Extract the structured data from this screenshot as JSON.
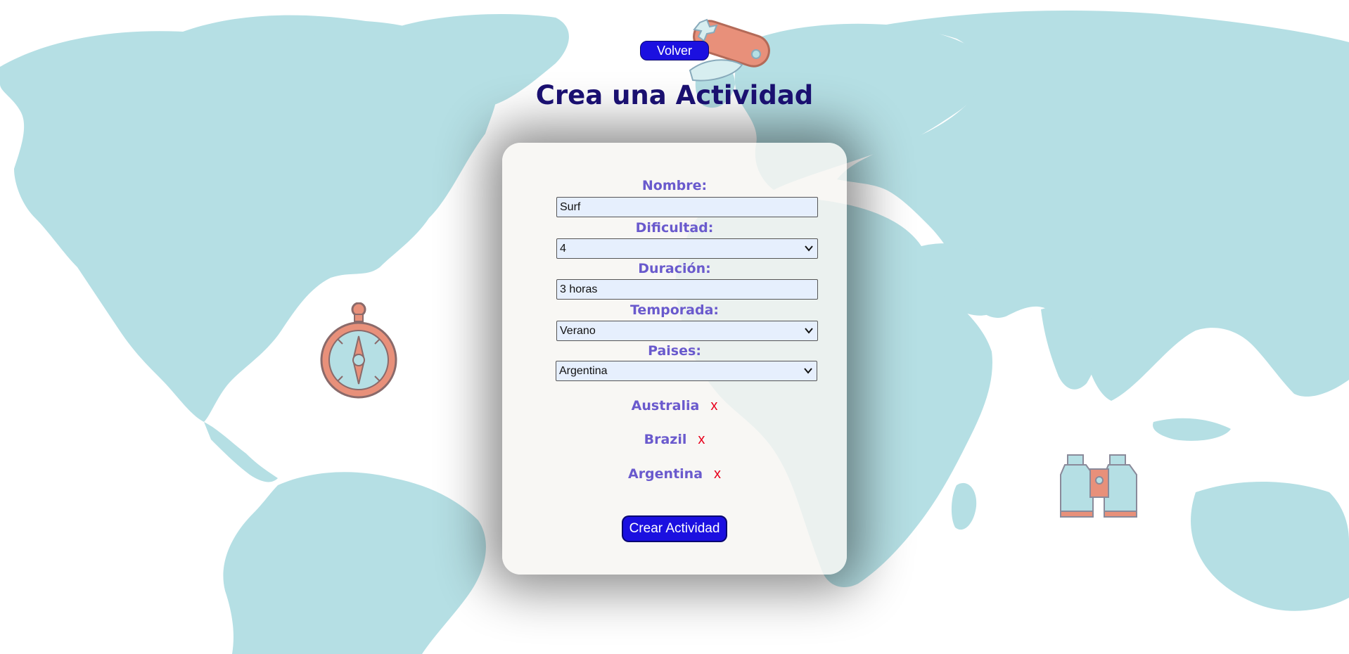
{
  "header": {
    "back_label": "Volver",
    "title": "Crea una Actividad"
  },
  "form": {
    "name_label": "Nombre:",
    "name_value": "Surf",
    "difficulty_label": "Dificultad:",
    "difficulty_value": "4",
    "duration_label": "Duración:",
    "duration_value": "3 horas",
    "season_label": "Temporada:",
    "season_value": "Verano",
    "countries_label": "Paises:",
    "countries_value": "Argentina",
    "selected_countries": [
      {
        "name": "Australia",
        "remove": "x"
      },
      {
        "name": "Brazil",
        "remove": "x"
      },
      {
        "name": "Argentina",
        "remove": "x"
      }
    ],
    "submit_label": "Crear Actividad"
  },
  "decorations": [
    "world-map",
    "pocket-knife-icon",
    "compass-icon",
    "binoculars-icon"
  ],
  "colors": {
    "map_land": "#b5dfe4",
    "button_bg": "#1b10e0",
    "title": "#1a1070",
    "label": "#6a5acd",
    "remove": "#e8001c",
    "icon_orange": "#e8907a"
  }
}
